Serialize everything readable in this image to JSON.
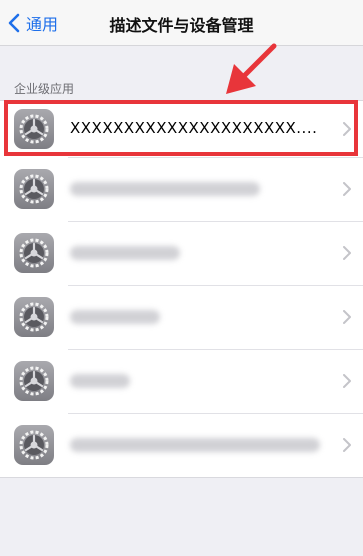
{
  "nav": {
    "back_label": "通用",
    "title": "描述文件与设备管理"
  },
  "section": {
    "header": "企业级应用"
  },
  "apps": [
    {
      "label": "XXXXXXXXXXXXXXXXXXXXX...."
    },
    {
      "label": ""
    },
    {
      "label": ""
    },
    {
      "label": ""
    },
    {
      "label": ""
    },
    {
      "label": ""
    }
  ],
  "colors": {
    "accent": "#1E6FEA",
    "highlight": "#E8353A",
    "background": "#EFEFF4"
  },
  "icons": {
    "back": "chevron-left-icon",
    "app": "settings-gear-icon",
    "disclosure": "chevron-right-icon",
    "annotation": "red-arrow-icon"
  }
}
